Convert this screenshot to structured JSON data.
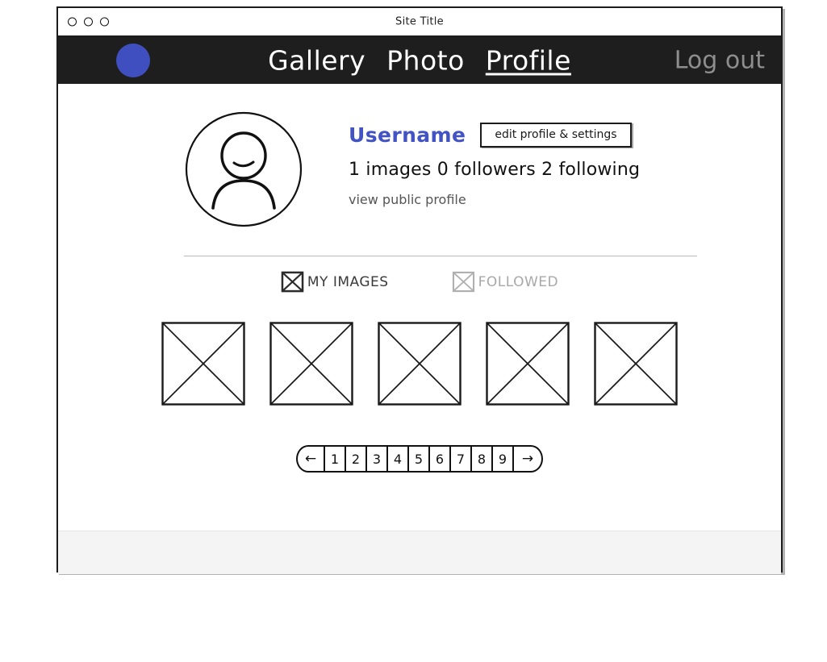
{
  "window": {
    "titlebar": {
      "title": "Site Title",
      "dots": [
        "window-dot",
        "window-dot",
        "window-dot"
      ]
    }
  },
  "navbar": {
    "brand_avatar_icon": "brand-avatar-circle",
    "brand_color": "#3f4fc0",
    "links": [
      {
        "label": "Gallery",
        "active": false
      },
      {
        "label": "Photo",
        "active": false
      },
      {
        "label": "Profile",
        "active": true
      }
    ],
    "logout_label": "Log out",
    "background_color": "#1e1e1e",
    "link_color": "#ffffff",
    "logout_color": "#8e8e8e"
  },
  "profile": {
    "avatar_icon": "user-avatar-icon",
    "username": "Username",
    "username_color": "#4254c4",
    "edit_button_label": "edit profile & settings",
    "stats": "1 images 0 followers 2 following",
    "stats_parts": {
      "images_count": "1",
      "images_label": "images",
      "followers_count": "0",
      "followers_label": "followers",
      "following_count": "2",
      "following_label": "following"
    },
    "view_public_profile_label": "view public profile"
  },
  "tabs": [
    {
      "label": "MY IMAGES",
      "icon": "crossed-box-icon",
      "active": true
    },
    {
      "label": "FOLLOWED",
      "icon": "crossed-box-icon",
      "active": false
    }
  ],
  "gallery": {
    "thumbnails": [
      {
        "placeholder": "crossed-box-placeholder"
      },
      {
        "placeholder": "crossed-box-placeholder"
      },
      {
        "placeholder": "crossed-box-placeholder"
      },
      {
        "placeholder": "crossed-box-placeholder"
      },
      {
        "placeholder": "crossed-box-placeholder"
      }
    ]
  },
  "pagination": {
    "prev_label": "←",
    "next_label": "→",
    "pages": [
      "1",
      "2",
      "3",
      "4",
      "5",
      "6",
      "7",
      "8",
      "9"
    ]
  }
}
